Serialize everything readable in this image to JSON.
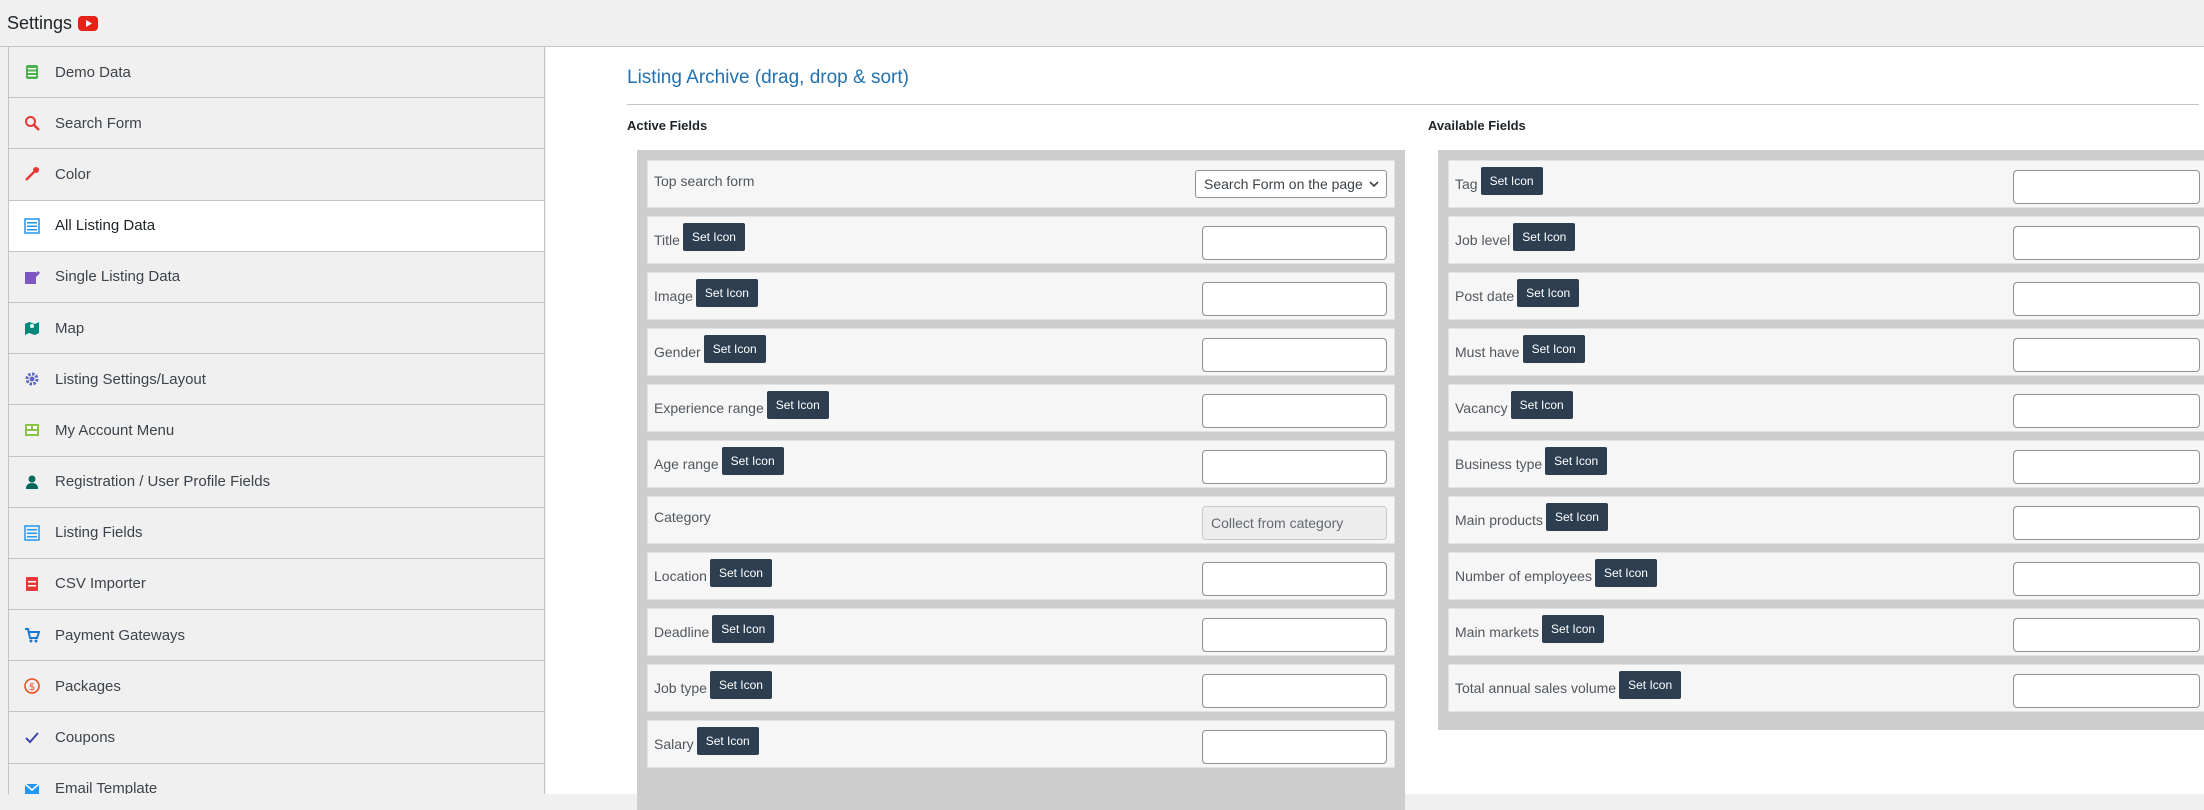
{
  "header": {
    "title": "Settings",
    "icon": "youtube-icon"
  },
  "sidebar": {
    "items": [
      {
        "label": "Demo Data",
        "icon": "database-icon",
        "color": "#4caf50"
      },
      {
        "label": "Search Form",
        "icon": "search-icon",
        "color": "#e53935"
      },
      {
        "label": "Color",
        "icon": "eyedropper-icon",
        "color": "#e53935"
      },
      {
        "label": "All Listing Data",
        "icon": "list-icon",
        "color": "#2196f3"
      },
      {
        "label": "Single Listing Data",
        "icon": "edit-icon",
        "color": "#7e57c2"
      },
      {
        "label": "Map",
        "icon": "map-icon",
        "color": "#00897b"
      },
      {
        "label": "Listing Settings/Layout",
        "icon": "gear-icon",
        "color": "#5c6bc0"
      },
      {
        "label": "My Account Menu",
        "icon": "menu-table-icon",
        "color": "#8bc34a"
      },
      {
        "label": "Registration / User Profile Fields",
        "icon": "user-icon",
        "color": "#00695c"
      },
      {
        "label": "Listing Fields",
        "icon": "list-icon",
        "color": "#2196f3"
      },
      {
        "label": "CSV Importer",
        "icon": "csv-icon",
        "color": "#e53935"
      },
      {
        "label": "Payment Gateways",
        "icon": "cart-icon",
        "color": "#1976d2"
      },
      {
        "label": "Packages",
        "icon": "dollar-icon",
        "color": "#e64a19"
      },
      {
        "label": "Coupons",
        "icon": "check-icon",
        "color": "#3949ab"
      },
      {
        "label": "Email Template",
        "icon": "mail-icon",
        "color": "#2196f3"
      }
    ],
    "active_index": 3
  },
  "main": {
    "title": "Listing Archive (drag, drop & sort)",
    "active_heading": "Active Fields",
    "available_heading": "Available Fields",
    "set_icon_label": "Set Icon",
    "active_fields": [
      {
        "label": "Top search form",
        "control": "select",
        "value": "Search Form on the page"
      },
      {
        "label": "Title",
        "control": "input",
        "value": ""
      },
      {
        "label": "Image",
        "control": "input",
        "value": ""
      },
      {
        "label": "Gender",
        "control": "input",
        "value": ""
      },
      {
        "label": "Experience range",
        "control": "input",
        "value": ""
      },
      {
        "label": "Age range",
        "control": "input",
        "value": ""
      },
      {
        "label": "Category",
        "control": "disabled",
        "value": "Collect from category"
      },
      {
        "label": "Location",
        "control": "input",
        "value": ""
      },
      {
        "label": "Deadline",
        "control": "input",
        "value": ""
      },
      {
        "label": "Job type",
        "control": "input",
        "value": ""
      },
      {
        "label": "Salary",
        "control": "input",
        "value": ""
      }
    ],
    "available_fields": [
      {
        "label": "Tag"
      },
      {
        "label": "Job level"
      },
      {
        "label": "Post date"
      },
      {
        "label": "Must have"
      },
      {
        "label": "Vacancy"
      },
      {
        "label": "Business type"
      },
      {
        "label": "Main products"
      },
      {
        "label": "Number of employees"
      },
      {
        "label": "Main markets"
      },
      {
        "label": "Total annual sales volume"
      }
    ]
  }
}
